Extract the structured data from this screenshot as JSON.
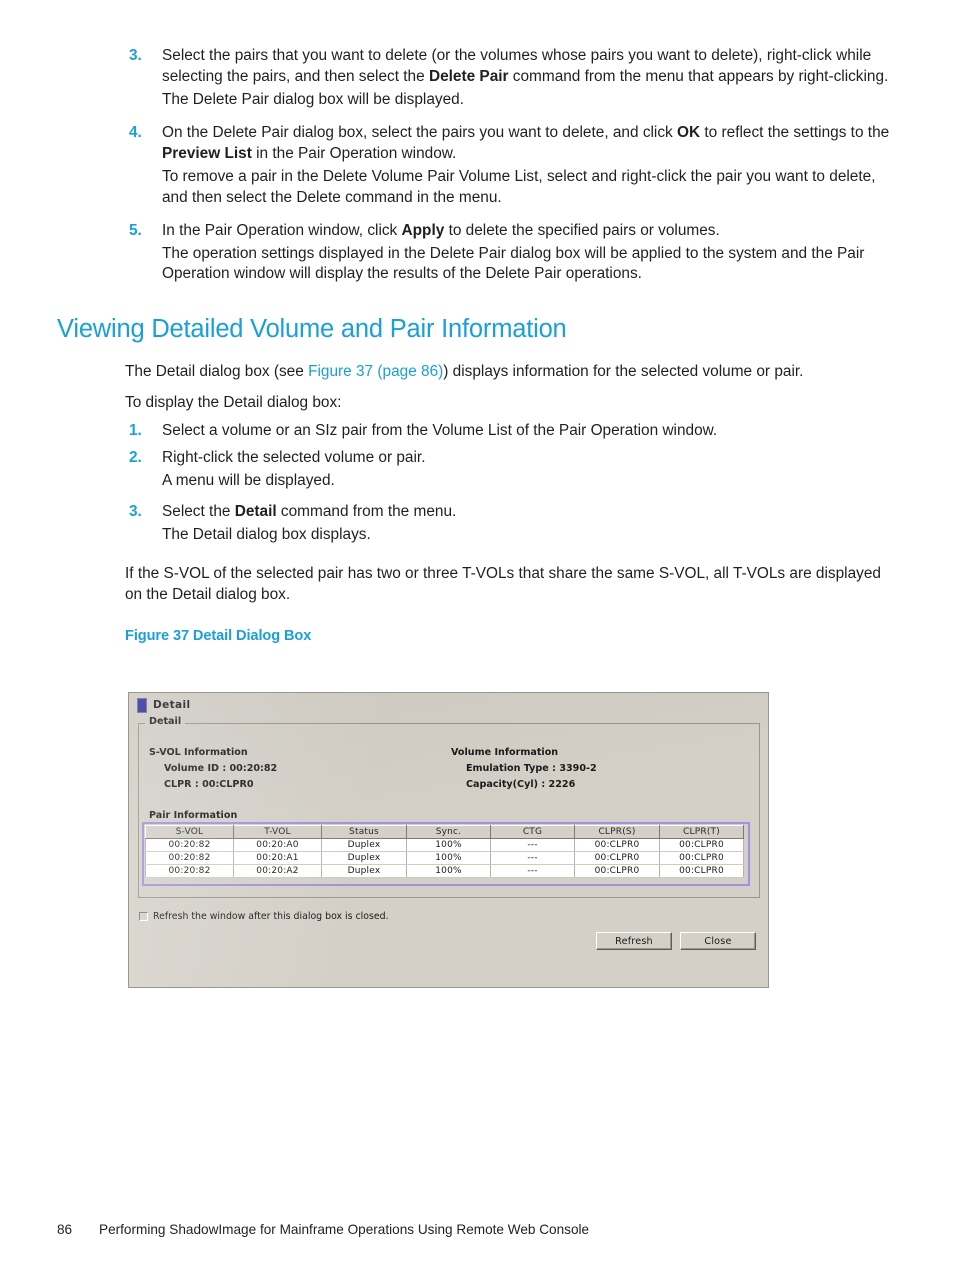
{
  "document": {
    "steps_continued": [
      {
        "number": "3.",
        "segments": [
          {
            "t": "Select the pairs that you want to delete (or the volumes whose pairs you want to delete), right-click while selecting the pairs, and then select the ",
            "b": false
          },
          {
            "t": "Delete Pair",
            "b": true
          },
          {
            "t": " command from the menu that appears by right-clicking.",
            "b": false
          }
        ],
        "follow_up": "The Delete Pair dialog box will be displayed."
      },
      {
        "number": "4.",
        "segments": [
          {
            "t": "On the Delete Pair dialog box, select the pairs you want to delete, and click ",
            "b": false
          },
          {
            "t": "OK",
            "b": true
          },
          {
            "t": " to reflect the settings to the ",
            "b": false
          },
          {
            "t": "Preview List",
            "b": true
          },
          {
            "t": " in the Pair Operation window.",
            "b": false
          }
        ],
        "follow_up": "To remove a pair in the Delete Volume Pair Volume List, select and right-click the pair you want to delete, and then select the Delete command in the menu."
      },
      {
        "number": "5.",
        "segments": [
          {
            "t": "In the Pair Operation window, click ",
            "b": false
          },
          {
            "t": "Apply",
            "b": true
          },
          {
            "t": " to delete the specified pairs or volumes.",
            "b": false
          }
        ],
        "follow_up": "The operation settings displayed in the Delete Pair dialog box will be applied to the system and the Pair Operation window will display the results of the Delete Pair operations."
      }
    ],
    "section_heading": "Viewing Detailed Volume and Pair Information",
    "intro": {
      "before_link": "The Detail dialog box (see ",
      "link": "Figure 37 (page 86)",
      "after_link": ") displays information for the selected volume or pair."
    },
    "lead_in": "To display the Detail dialog box:",
    "steps": [
      {
        "number": "1.",
        "segments": [
          {
            "t": "Select a volume or an SIz pair from the Volume List of the Pair Operation window.",
            "b": false
          }
        ],
        "follow_up": ""
      },
      {
        "number": "2.",
        "segments": [
          {
            "t": "Right-click the selected volume or pair.",
            "b": false
          }
        ],
        "follow_up": "A menu will be displayed."
      },
      {
        "number": "3.",
        "segments": [
          {
            "t": "Select the ",
            "b": false
          },
          {
            "t": "Detail",
            "b": true
          },
          {
            "t": " command from the menu.",
            "b": false
          }
        ],
        "follow_up": "The Detail dialog box displays."
      }
    ],
    "closing_paragraph": "If the S-VOL of the selected pair has two or three T-VOLs that share the same S-VOL, all T-VOLs are displayed on the Detail dialog box.",
    "figure_caption": "Figure 37 Detail Dialog Box",
    "footer": {
      "page_number": "86",
      "running_title": "Performing ShadowImage for Mainframe Operations Using Remote Web Console"
    },
    "colors": {
      "accent_blue": "#1a9fd9",
      "body_text": "#231f20"
    }
  },
  "dialog": {
    "title": "Detail",
    "window_icon": "window-icon",
    "groupbox_legend": "Detail",
    "svol_information": {
      "heading": "S-VOL Information",
      "fields": [
        {
          "label": "Volume ID :",
          "value": "00:20:82",
          "full": "Volume ID : 00:20:82"
        },
        {
          "label": "CLPR :",
          "value": "00:CLPR0",
          "full": "CLPR : 00:CLPR0"
        }
      ]
    },
    "volume_information": {
      "heading": "Volume Information",
      "fields": [
        {
          "label": "Emulation Type :",
          "value": "3390-2",
          "full": "Emulation Type : 3390-2"
        },
        {
          "label": "Capacity(Cyl) :",
          "value": "2226",
          "full": "Capacity(Cyl) : 2226"
        }
      ]
    },
    "pair_information": {
      "heading": "Pair Information",
      "columns": [
        "S-VOL",
        "T-VOL",
        "Status",
        "Sync.",
        "CTG",
        "CLPR(S)",
        "CLPR(T)"
      ],
      "rows": [
        [
          "00:20:82",
          "00:20:A0",
          "Duplex",
          "100%",
          "---",
          "00:CLPR0",
          "00:CLPR0"
        ],
        [
          "00:20:82",
          "00:20:A1",
          "Duplex",
          "100%",
          "---",
          "00:CLPR0",
          "00:CLPR0"
        ],
        [
          "00:20:82",
          "00:20:A2",
          "Duplex",
          "100%",
          "---",
          "00:CLPR0",
          "00:CLPR0"
        ]
      ],
      "border_color": "#9d93e0"
    },
    "refresh_checkbox": {
      "label": "Refresh the window after this dialog box is closed.",
      "checked": false
    },
    "buttons": [
      {
        "label": "Refresh",
        "name": "refresh-button"
      },
      {
        "label": "Close",
        "name": "close-button"
      }
    ]
  }
}
